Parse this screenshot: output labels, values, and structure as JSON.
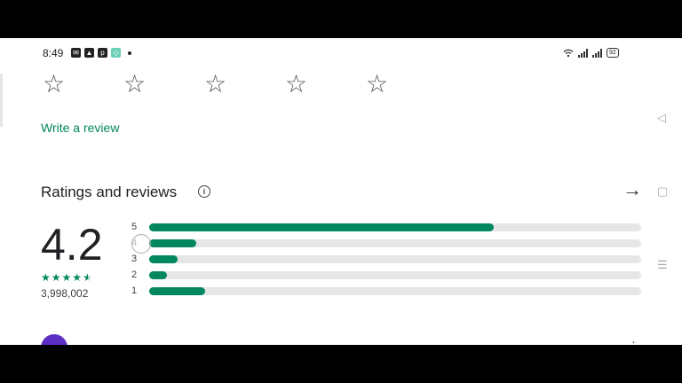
{
  "status_bar": {
    "time": "8:49",
    "battery": "92"
  },
  "rate": {
    "stars": [
      "star-1",
      "star-2",
      "star-3",
      "star-4",
      "star-5"
    ],
    "star_glyph": "☆",
    "write_review": "Write a review"
  },
  "ratings": {
    "title": "Ratings and reviews",
    "info_glyph": "i",
    "arrow_glyph": "→",
    "average": "4.2",
    "mini_star_glyph": "★",
    "count": "3,998,002",
    "distribution": [
      {
        "label": "5",
        "fraction": 0.7
      },
      {
        "label": "4",
        "fraction": 0.095
      },
      {
        "label": "3",
        "fraction": 0.058
      },
      {
        "label": "2",
        "fraction": 0.036
      },
      {
        "label": "1",
        "fraction": 0.113
      }
    ],
    "accent_color": "#01875f"
  },
  "system_nav": {
    "back": "◁",
    "home": "▢",
    "menu": "☰"
  }
}
